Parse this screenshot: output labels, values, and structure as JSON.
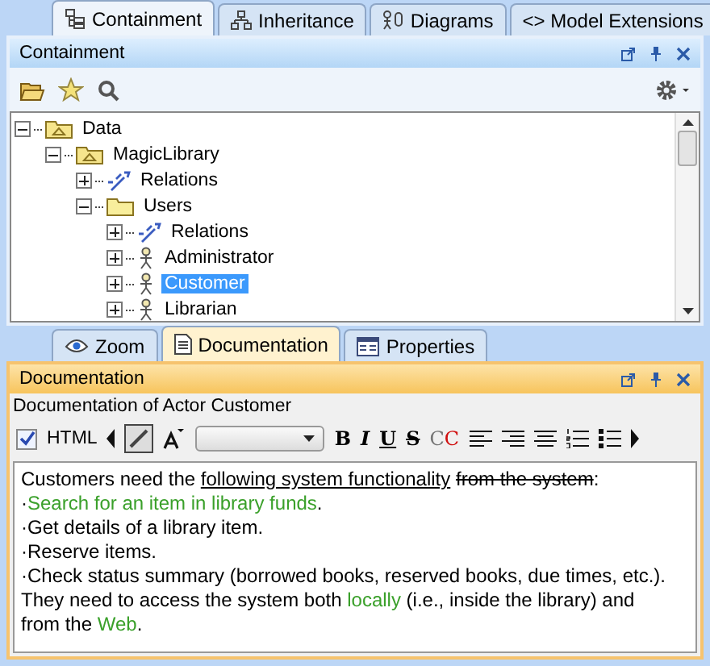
{
  "top_tabs": [
    {
      "label": "Containment",
      "kind": "tree",
      "selected": true
    },
    {
      "label": "Inheritance",
      "kind": "hierarchy",
      "selected": false
    },
    {
      "label": "Diagrams",
      "kind": "diagram",
      "selected": false
    },
    {
      "label": "<> Model Extensions",
      "kind": "text",
      "selected": false
    }
  ],
  "browser": {
    "title": "Containment",
    "tree": [
      {
        "label": "Data",
        "kind": "package",
        "expanded": true,
        "selected": false,
        "children": [
          {
            "label": "MagicLibrary",
            "kind": "package",
            "expanded": true,
            "selected": false,
            "children": [
              {
                "label": "Relations",
                "kind": "relations",
                "expanded": false,
                "selected": false
              },
              {
                "label": "Users",
                "kind": "folder",
                "expanded": true,
                "selected": false,
                "children": [
                  {
                    "label": "Relations",
                    "kind": "relations",
                    "expanded": false,
                    "selected": false
                  },
                  {
                    "label": "Administrator",
                    "kind": "actor",
                    "expanded": false,
                    "selected": false
                  },
                  {
                    "label": "Customer",
                    "kind": "actor",
                    "expanded": false,
                    "selected": true
                  },
                  {
                    "label": "Librarian",
                    "kind": "actor",
                    "expanded": false,
                    "selected": false
                  }
                ]
              }
            ]
          }
        ]
      }
    ]
  },
  "bottom_tabs": [
    {
      "label": "Zoom",
      "kind": "eye",
      "selected": false
    },
    {
      "label": "Documentation",
      "kind": "document",
      "selected": true
    },
    {
      "label": "Properties",
      "kind": "table",
      "selected": false
    }
  ],
  "documentation": {
    "title": "Documentation",
    "subtitle": "Documentation of Actor Customer",
    "html": {
      "label": "HTML",
      "checked": true
    },
    "format_buttons": [
      {
        "kind": "bold",
        "label": "B"
      },
      {
        "kind": "italic",
        "label": "I"
      },
      {
        "kind": "underline",
        "label": "U"
      },
      {
        "kind": "strike",
        "label": "S"
      },
      {
        "kind": "case",
        "label": "CC"
      }
    ],
    "text": [
      [
        {
          "kind": "plain",
          "text": "Customers need the "
        },
        {
          "kind": "underline",
          "text": "following system functionality"
        },
        {
          "kind": "strike",
          "text": " from the system"
        },
        {
          "kind": "plain",
          "text": ":"
        }
      ],
      [
        {
          "kind": "plain",
          "text": "·"
        },
        {
          "kind": "green",
          "text": "Search for an item in library funds"
        },
        {
          "kind": "plain",
          "text": "."
        }
      ],
      [
        {
          "kind": "plain",
          "text": "·Get details of a library item."
        }
      ],
      [
        {
          "kind": "plain",
          "text": "·Reserve items."
        }
      ],
      [
        {
          "kind": "plain",
          "text": "·Check status summary (borrowed books, reserved books, due times, etc.)."
        }
      ],
      [
        {
          "kind": "plain",
          "text": "They need to access the system both "
        },
        {
          "kind": "green",
          "text": "locally"
        },
        {
          "kind": "plain",
          "text": " (i.e., inside the library) and from the "
        },
        {
          "kind": "green",
          "text": "Web"
        },
        {
          "kind": "plain",
          "text": "."
        }
      ]
    ]
  }
}
